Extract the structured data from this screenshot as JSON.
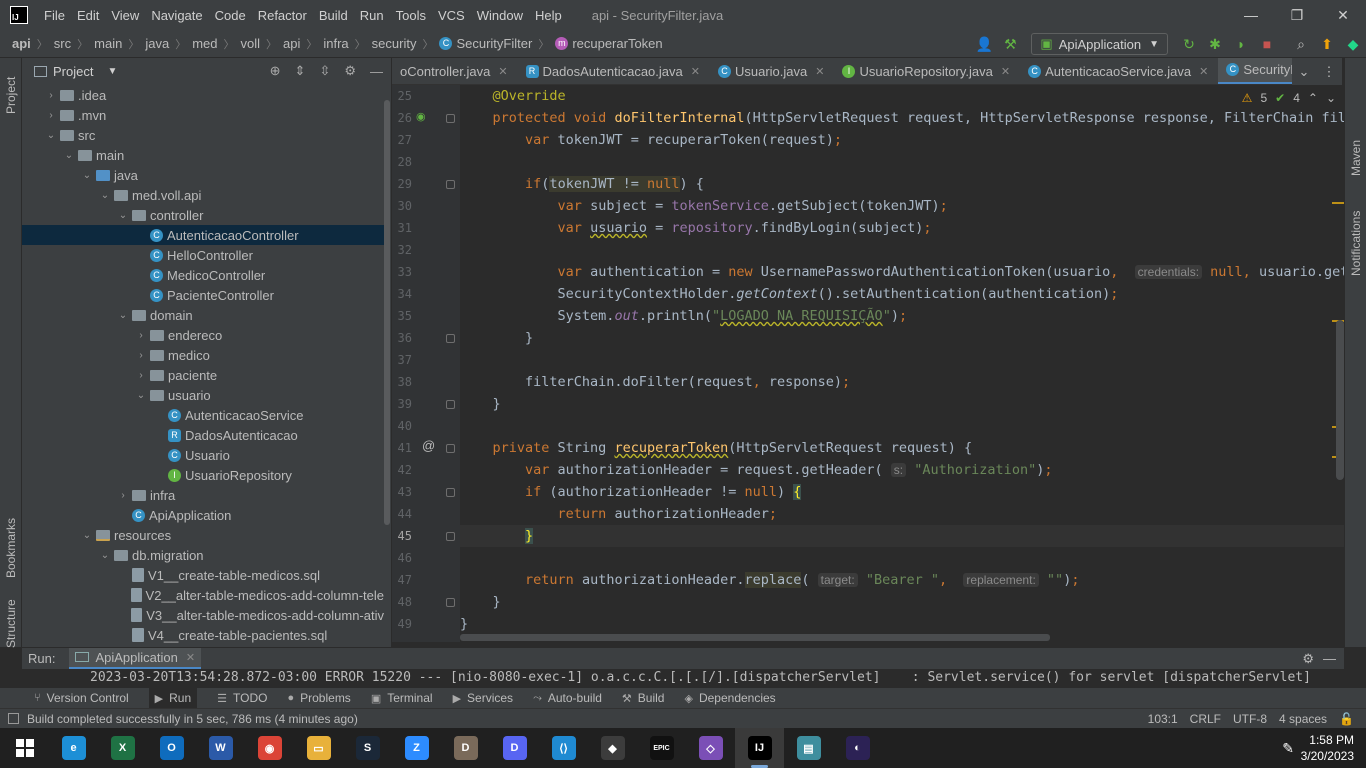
{
  "window": {
    "title": "api - SecurityFilter.java",
    "menus": [
      "File",
      "Edit",
      "View",
      "Navigate",
      "Code",
      "Refactor",
      "Build",
      "Run",
      "Tools",
      "VCS",
      "Window",
      "Help"
    ]
  },
  "breadcrumb": [
    "api",
    "src",
    "main",
    "java",
    "med",
    "voll",
    "api",
    "infra",
    "security",
    "SecurityFilter",
    "recuperarToken"
  ],
  "run_config": "ApiApplication",
  "project_panel": {
    "title": "Project",
    "tree": [
      {
        "label": ".idea",
        "arrow": "›",
        "depth": 0,
        "icon": "folder"
      },
      {
        "label": ".mvn",
        "arrow": "›",
        "depth": 0,
        "icon": "folder"
      },
      {
        "label": "src",
        "arrow": "⌄",
        "depth": 0,
        "icon": "folder"
      },
      {
        "label": "main",
        "arrow": "⌄",
        "depth": 1,
        "icon": "folder"
      },
      {
        "label": "java",
        "arrow": "⌄",
        "depth": 2,
        "icon": "folder-blue"
      },
      {
        "label": "med.voll.api",
        "arrow": "⌄",
        "depth": 3,
        "icon": "folder"
      },
      {
        "label": "controller",
        "arrow": "⌄",
        "depth": 4,
        "icon": "folder"
      },
      {
        "label": "AutenticacaoController",
        "arrow": "",
        "depth": 5,
        "icon": "class",
        "selected": true
      },
      {
        "label": "HelloController",
        "arrow": "",
        "depth": 5,
        "icon": "class"
      },
      {
        "label": "MedicoController",
        "arrow": "",
        "depth": 5,
        "icon": "class"
      },
      {
        "label": "PacienteController",
        "arrow": "",
        "depth": 5,
        "icon": "class"
      },
      {
        "label": "domain",
        "arrow": "⌄",
        "depth": 4,
        "icon": "folder"
      },
      {
        "label": "endereco",
        "arrow": "›",
        "depth": 5,
        "icon": "folder"
      },
      {
        "label": "medico",
        "arrow": "›",
        "depth": 5,
        "icon": "folder"
      },
      {
        "label": "paciente",
        "arrow": "›",
        "depth": 5,
        "icon": "folder"
      },
      {
        "label": "usuario",
        "arrow": "⌄",
        "depth": 5,
        "icon": "folder"
      },
      {
        "label": "AutenticacaoService",
        "arrow": "",
        "depth": 6,
        "icon": "class"
      },
      {
        "label": "DadosAutenticacao",
        "arrow": "",
        "depth": 6,
        "icon": "record"
      },
      {
        "label": "Usuario",
        "arrow": "",
        "depth": 6,
        "icon": "class"
      },
      {
        "label": "UsuarioRepository",
        "arrow": "",
        "depth": 6,
        "icon": "interface"
      },
      {
        "label": "infra",
        "arrow": "›",
        "depth": 4,
        "icon": "folder"
      },
      {
        "label": "ApiApplication",
        "arrow": "",
        "depth": 4,
        "icon": "class"
      },
      {
        "label": "resources",
        "arrow": "⌄",
        "depth": 2,
        "icon": "folder-res"
      },
      {
        "label": "db.migration",
        "arrow": "⌄",
        "depth": 3,
        "icon": "folder"
      },
      {
        "label": "V1__create-table-medicos.sql",
        "arrow": "",
        "depth": 4,
        "icon": "sql"
      },
      {
        "label": "V2__alter-table-medicos-add-column-tele",
        "arrow": "",
        "depth": 4,
        "icon": "sql"
      },
      {
        "label": "V3__alter-table-medicos-add-column-ativ",
        "arrow": "",
        "depth": 4,
        "icon": "sql"
      },
      {
        "label": "V4__create-table-pacientes.sql",
        "arrow": "",
        "depth": 4,
        "icon": "sql"
      }
    ]
  },
  "editor_tabs": [
    {
      "label": "oController.java",
      "icon": "none",
      "active": false
    },
    {
      "label": "DadosAutenticacao.java",
      "icon": "record",
      "active": false
    },
    {
      "label": "Usuario.java",
      "icon": "class",
      "active": false
    },
    {
      "label": "UsuarioRepository.java",
      "icon": "interface",
      "active": false
    },
    {
      "label": "AutenticacaoService.java",
      "icon": "class",
      "active": false
    },
    {
      "label": "SecurityFilter.java",
      "icon": "class",
      "active": true
    }
  ],
  "inspections": {
    "warnings": "5",
    "checks": "4"
  },
  "code": {
    "lines": [
      {
        "n": "25",
        "html": "<span class=\"an\">    @Override</span>"
      },
      {
        "n": "26",
        "html": "    <span class=\"kw\">protected void </span><span class=\"fn\">doFilterInternal</span>(HttpServletRequest request, HttpServletResponse response, FilterChain filte"
      },
      {
        "n": "27",
        "html": "        <span class=\"kw\">var </span>tokenJWT = recuperarToken(request)<span class=\"kw\">;</span>"
      },
      {
        "n": "28",
        "html": ""
      },
      {
        "n": "29",
        "html": "        <span class=\"kw\">if</span>(<span class=\"hl\">tokenJWT != <span class=\"kw\">null</span></span>) {"
      },
      {
        "n": "30",
        "html": "            <span class=\"kw\">var </span>subject = <span class=\"fd\">tokenService</span>.getSubject(tokenJWT)<span class=\"kw\">;</span>"
      },
      {
        "n": "31",
        "html": "            <span class=\"kw\">var </span><span class=\"uw\">usuario</span> = <span class=\"fd\">repository</span>.findByLogin(subject)<span class=\"kw\">;</span>"
      },
      {
        "n": "32",
        "html": ""
      },
      {
        "n": "33",
        "html": "            <span class=\"kw\">var </span>authentication = <span class=\"kw\">new </span>UsernamePasswordAuthenticationToken(usuario<span class=\"kw\">, </span> <span class=\"hint\">credentials:</span> <span class=\"kw\">null, </span>usuario.getAut"
      },
      {
        "n": "34",
        "html": "            SecurityContextHolder.<span class=\"it\">getContext</span>().setAuthentication(authentication)<span class=\"kw\">;</span>"
      },
      {
        "n": "35",
        "html": "            System.<span class=\"fd it\">out</span>.println(<span class=\"st\">\"<span class=\"uw\">LOGADO NA REQUISIÇÃO</span>\"</span>)<span class=\"kw\">;</span>"
      },
      {
        "n": "36",
        "html": "        }"
      },
      {
        "n": "37",
        "html": ""
      },
      {
        "n": "38",
        "html": "        filterChain.doFilter(request<span class=\"kw\">, </span>response)<span class=\"kw\">;</span>"
      },
      {
        "n": "39",
        "html": "    }"
      },
      {
        "n": "40",
        "html": ""
      },
      {
        "n": "41",
        "html": "    <span class=\"kw\">private </span>String <span class=\"fn uw\">recuperarToken</span>(HttpServletRequest request) {"
      },
      {
        "n": "42",
        "html": "        <span class=\"kw\">var </span>authorizationHeader = request.getHeader( <span class=\"hint\">s:</span> <span class=\"st\">\"Authorization\"</span>)<span class=\"kw\">;</span>"
      },
      {
        "n": "43",
        "html": "        <span class=\"kw\">if </span>(authorizationHeader != <span class=\"kw\">null</span>) <span class=\"brace-hl\">{</span>"
      },
      {
        "n": "44",
        "html": "            <span class=\"kw\">return </span>authorizationHeader<span class=\"kw\">;</span>"
      },
      {
        "n": "45",
        "html": "        <span class=\"brace-hl\">}</span>",
        "current": true
      },
      {
        "n": "46",
        "html": ""
      },
      {
        "n": "47",
        "html": "        <span class=\"kw\">return </span>authorizationHeader.<span class=\"hl\">replace</span>( <span class=\"hint\">target:</span> <span class=\"st\">\"Bearer \"</span><span class=\"kw\">, </span> <span class=\"hint\">replacement:</span> <span class=\"st\">\"\"</span>)<span class=\"kw\">;</span>"
      },
      {
        "n": "48",
        "html": "    }"
      },
      {
        "n": "49",
        "html": "}"
      }
    ]
  },
  "run_panel": {
    "label": "Run:",
    "tab": "ApiApplication",
    "log": "2023-03-20T13:54:28.872-03:00 ERROR 15220 --- [nio-8080-exec-1] o.a.c.c.C.[.[.[/].[dispatcherServlet]    : Servlet.service() for servlet [dispatcherServlet]"
  },
  "tool_windows": [
    {
      "label": "Version Control",
      "glyph": "⑂"
    },
    {
      "label": "Run",
      "glyph": "▶",
      "active": true
    },
    {
      "label": "TODO",
      "glyph": "☰"
    },
    {
      "label": "Problems",
      "glyph": "●"
    },
    {
      "label": "Terminal",
      "glyph": "▣"
    },
    {
      "label": "Services",
      "glyph": "▶"
    },
    {
      "label": "Auto-build",
      "glyph": "⤳"
    },
    {
      "label": "Build",
      "glyph": "⚒"
    },
    {
      "label": "Dependencies",
      "glyph": "◈"
    }
  ],
  "status_bar": {
    "message": "Build completed successfully in 5 sec, 786 ms (4 minutes ago)",
    "position": "103:1",
    "line_sep": "CRLF",
    "encoding": "UTF-8",
    "indent": "4 spaces"
  },
  "side_labels": {
    "project": "Project",
    "bookmarks": "Bookmarks",
    "structure": "Structure",
    "maven": "Maven",
    "notifications": "Notifications"
  },
  "taskbar": {
    "apps": [
      {
        "name": "edge",
        "color": "#1d8fd6",
        "glyph": "e"
      },
      {
        "name": "excel",
        "color": "#1f7244",
        "glyph": "X"
      },
      {
        "name": "outlook",
        "color": "#0f6cbd",
        "glyph": "O"
      },
      {
        "name": "word",
        "color": "#2b5aa8",
        "glyph": "W"
      },
      {
        "name": "chrome",
        "color": "#db4437",
        "glyph": "◉"
      },
      {
        "name": "explorer",
        "color": "#e8b13a",
        "glyph": "▭"
      },
      {
        "name": "steam",
        "color": "#1b2838",
        "glyph": "S"
      },
      {
        "name": "zoom",
        "color": "#2d8cff",
        "glyph": "Z"
      },
      {
        "name": "dbeaver",
        "color": "#7a6a5a",
        "glyph": "D"
      },
      {
        "name": "discord",
        "color": "#5865f2",
        "glyph": "D"
      },
      {
        "name": "vscode",
        "color": "#1f8ad2",
        "glyph": "⟨⟩"
      },
      {
        "name": "git",
        "color": "#3c3c3c",
        "glyph": "◆"
      },
      {
        "name": "epic",
        "color": "#111111",
        "glyph": "EPIC"
      },
      {
        "name": "visualstudio",
        "color": "#7b4fb6",
        "glyph": "◇"
      },
      {
        "name": "intellij",
        "color": "#000000",
        "glyph": "IJ",
        "active": true
      },
      {
        "name": "notes",
        "color": "#3e8e9e",
        "glyph": "▤"
      },
      {
        "name": "eclipse",
        "color": "#2c2255",
        "glyph": "◐"
      }
    ],
    "time": "1:58 PM",
    "date": "3/20/2023"
  }
}
